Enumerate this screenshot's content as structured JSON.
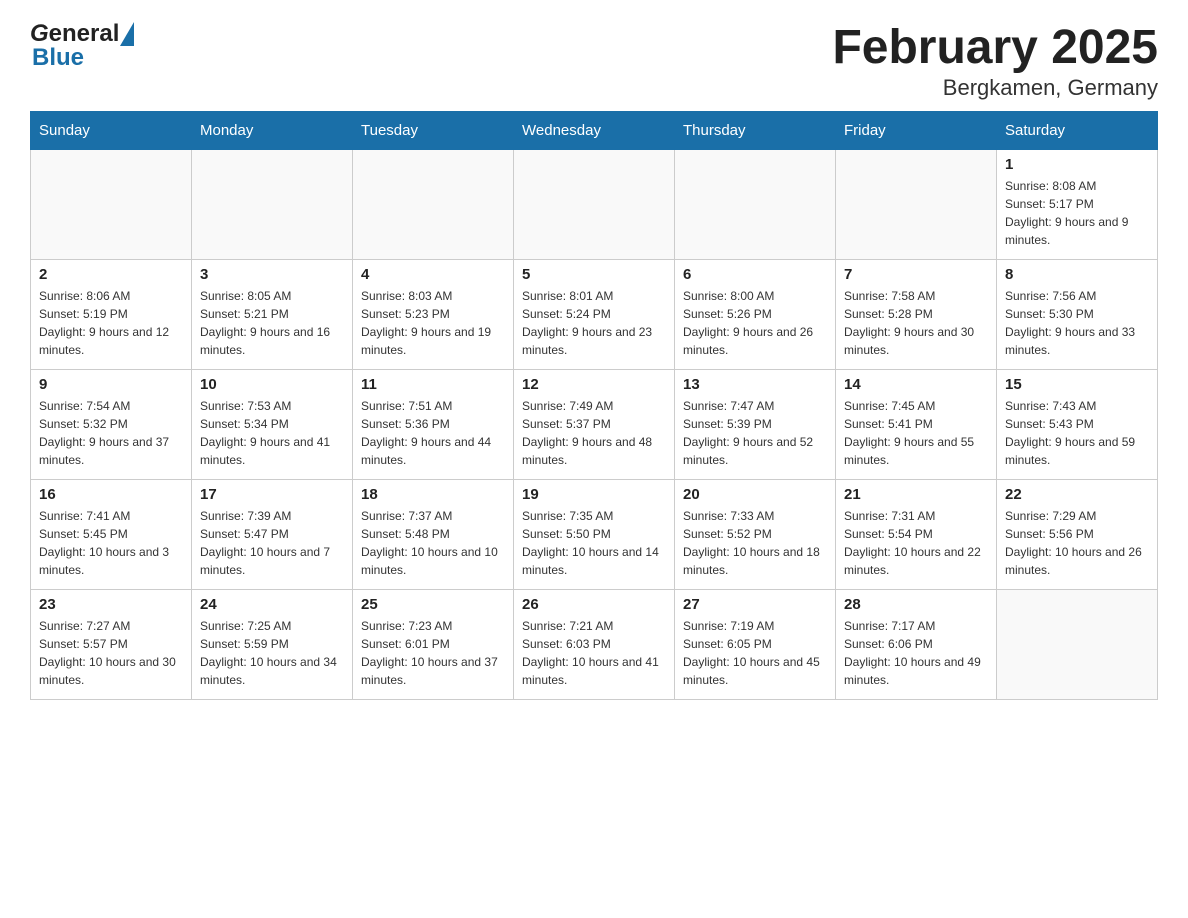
{
  "header": {
    "title": "February 2025",
    "subtitle": "Bergkamen, Germany",
    "logo_general": "General",
    "logo_blue": "Blue"
  },
  "days_of_week": [
    "Sunday",
    "Monday",
    "Tuesday",
    "Wednesday",
    "Thursday",
    "Friday",
    "Saturday"
  ],
  "weeks": [
    {
      "days": [
        {
          "number": "",
          "info": "",
          "empty": true
        },
        {
          "number": "",
          "info": "",
          "empty": true
        },
        {
          "number": "",
          "info": "",
          "empty": true
        },
        {
          "number": "",
          "info": "",
          "empty": true
        },
        {
          "number": "",
          "info": "",
          "empty": true
        },
        {
          "number": "",
          "info": "",
          "empty": true
        },
        {
          "number": "1",
          "info": "Sunrise: 8:08 AM\nSunset: 5:17 PM\nDaylight: 9 hours and 9 minutes.",
          "empty": false
        }
      ]
    },
    {
      "days": [
        {
          "number": "2",
          "info": "Sunrise: 8:06 AM\nSunset: 5:19 PM\nDaylight: 9 hours and 12 minutes.",
          "empty": false
        },
        {
          "number": "3",
          "info": "Sunrise: 8:05 AM\nSunset: 5:21 PM\nDaylight: 9 hours and 16 minutes.",
          "empty": false
        },
        {
          "number": "4",
          "info": "Sunrise: 8:03 AM\nSunset: 5:23 PM\nDaylight: 9 hours and 19 minutes.",
          "empty": false
        },
        {
          "number": "5",
          "info": "Sunrise: 8:01 AM\nSunset: 5:24 PM\nDaylight: 9 hours and 23 minutes.",
          "empty": false
        },
        {
          "number": "6",
          "info": "Sunrise: 8:00 AM\nSunset: 5:26 PM\nDaylight: 9 hours and 26 minutes.",
          "empty": false
        },
        {
          "number": "7",
          "info": "Sunrise: 7:58 AM\nSunset: 5:28 PM\nDaylight: 9 hours and 30 minutes.",
          "empty": false
        },
        {
          "number": "8",
          "info": "Sunrise: 7:56 AM\nSunset: 5:30 PM\nDaylight: 9 hours and 33 minutes.",
          "empty": false
        }
      ]
    },
    {
      "days": [
        {
          "number": "9",
          "info": "Sunrise: 7:54 AM\nSunset: 5:32 PM\nDaylight: 9 hours and 37 minutes.",
          "empty": false
        },
        {
          "number": "10",
          "info": "Sunrise: 7:53 AM\nSunset: 5:34 PM\nDaylight: 9 hours and 41 minutes.",
          "empty": false
        },
        {
          "number": "11",
          "info": "Sunrise: 7:51 AM\nSunset: 5:36 PM\nDaylight: 9 hours and 44 minutes.",
          "empty": false
        },
        {
          "number": "12",
          "info": "Sunrise: 7:49 AM\nSunset: 5:37 PM\nDaylight: 9 hours and 48 minutes.",
          "empty": false
        },
        {
          "number": "13",
          "info": "Sunrise: 7:47 AM\nSunset: 5:39 PM\nDaylight: 9 hours and 52 minutes.",
          "empty": false
        },
        {
          "number": "14",
          "info": "Sunrise: 7:45 AM\nSunset: 5:41 PM\nDaylight: 9 hours and 55 minutes.",
          "empty": false
        },
        {
          "number": "15",
          "info": "Sunrise: 7:43 AM\nSunset: 5:43 PM\nDaylight: 9 hours and 59 minutes.",
          "empty": false
        }
      ]
    },
    {
      "days": [
        {
          "number": "16",
          "info": "Sunrise: 7:41 AM\nSunset: 5:45 PM\nDaylight: 10 hours and 3 minutes.",
          "empty": false
        },
        {
          "number": "17",
          "info": "Sunrise: 7:39 AM\nSunset: 5:47 PM\nDaylight: 10 hours and 7 minutes.",
          "empty": false
        },
        {
          "number": "18",
          "info": "Sunrise: 7:37 AM\nSunset: 5:48 PM\nDaylight: 10 hours and 10 minutes.",
          "empty": false
        },
        {
          "number": "19",
          "info": "Sunrise: 7:35 AM\nSunset: 5:50 PM\nDaylight: 10 hours and 14 minutes.",
          "empty": false
        },
        {
          "number": "20",
          "info": "Sunrise: 7:33 AM\nSunset: 5:52 PM\nDaylight: 10 hours and 18 minutes.",
          "empty": false
        },
        {
          "number": "21",
          "info": "Sunrise: 7:31 AM\nSunset: 5:54 PM\nDaylight: 10 hours and 22 minutes.",
          "empty": false
        },
        {
          "number": "22",
          "info": "Sunrise: 7:29 AM\nSunset: 5:56 PM\nDaylight: 10 hours and 26 minutes.",
          "empty": false
        }
      ]
    },
    {
      "days": [
        {
          "number": "23",
          "info": "Sunrise: 7:27 AM\nSunset: 5:57 PM\nDaylight: 10 hours and 30 minutes.",
          "empty": false
        },
        {
          "number": "24",
          "info": "Sunrise: 7:25 AM\nSunset: 5:59 PM\nDaylight: 10 hours and 34 minutes.",
          "empty": false
        },
        {
          "number": "25",
          "info": "Sunrise: 7:23 AM\nSunset: 6:01 PM\nDaylight: 10 hours and 37 minutes.",
          "empty": false
        },
        {
          "number": "26",
          "info": "Sunrise: 7:21 AM\nSunset: 6:03 PM\nDaylight: 10 hours and 41 minutes.",
          "empty": false
        },
        {
          "number": "27",
          "info": "Sunrise: 7:19 AM\nSunset: 6:05 PM\nDaylight: 10 hours and 45 minutes.",
          "empty": false
        },
        {
          "number": "28",
          "info": "Sunrise: 7:17 AM\nSunset: 6:06 PM\nDaylight: 10 hours and 49 minutes.",
          "empty": false
        },
        {
          "number": "",
          "info": "",
          "empty": true
        }
      ]
    }
  ]
}
